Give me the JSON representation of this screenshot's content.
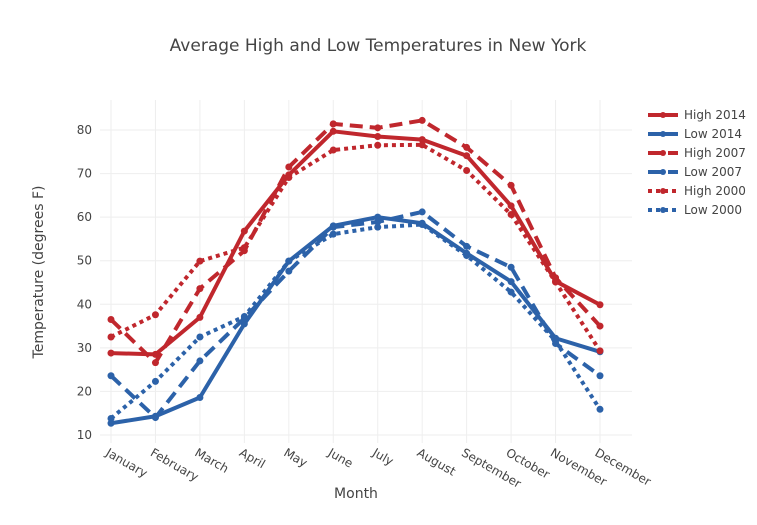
{
  "chart_data": {
    "type": "line",
    "title": "Average High and Low Temperatures in New York",
    "xlabel": "Month",
    "ylabel": "Temperature (degrees F)",
    "categories": [
      "January",
      "February",
      "March",
      "April",
      "May",
      "June",
      "July",
      "August",
      "September",
      "October",
      "November",
      "December"
    ],
    "yticks": [
      10,
      20,
      30,
      40,
      50,
      60,
      70,
      80
    ],
    "ylim": [
      8.3,
      84.1
    ],
    "grid": true,
    "legend_position": "top-right",
    "series": [
      {
        "name": "High 2014",
        "color": "#c0272d",
        "dash": "solid",
        "values": [
          28.8,
          28.5,
          37.0,
          56.8,
          69.7,
          79.7,
          78.5,
          77.8,
          74.1,
          62.6,
          45.3,
          39.9
        ]
      },
      {
        "name": "Low 2014",
        "color": "#2c62a9",
        "dash": "solid",
        "values": [
          12.7,
          14.3,
          18.6,
          35.5,
          49.9,
          58.0,
          60.0,
          58.6,
          51.7,
          45.2,
          32.2,
          29.1
        ]
      },
      {
        "name": "High 2007",
        "color": "#c0272d",
        "dash": "dash",
        "values": [
          36.5,
          26.6,
          43.6,
          52.3,
          71.5,
          81.4,
          80.5,
          82.2,
          76.0,
          67.3,
          46.1,
          35.0
        ]
      },
      {
        "name": "Low 2007",
        "color": "#2c62a9",
        "dash": "dash",
        "values": [
          23.6,
          14.0,
          27.0,
          36.8,
          47.6,
          57.7,
          58.9,
          61.2,
          53.3,
          48.5,
          31.0,
          23.6
        ]
      },
      {
        "name": "High 2000",
        "color": "#c0272d",
        "dash": "dot",
        "values": [
          32.5,
          37.6,
          49.9,
          53.0,
          69.1,
          75.4,
          76.5,
          76.6,
          70.7,
          60.6,
          45.1,
          29.3
        ]
      },
      {
        "name": "Low 2000",
        "color": "#2c62a9",
        "dash": "dot",
        "values": [
          13.8,
          22.3,
          32.5,
          37.2,
          49.9,
          56.1,
          57.7,
          58.3,
          51.2,
          42.8,
          31.6,
          15.9
        ]
      }
    ]
  }
}
